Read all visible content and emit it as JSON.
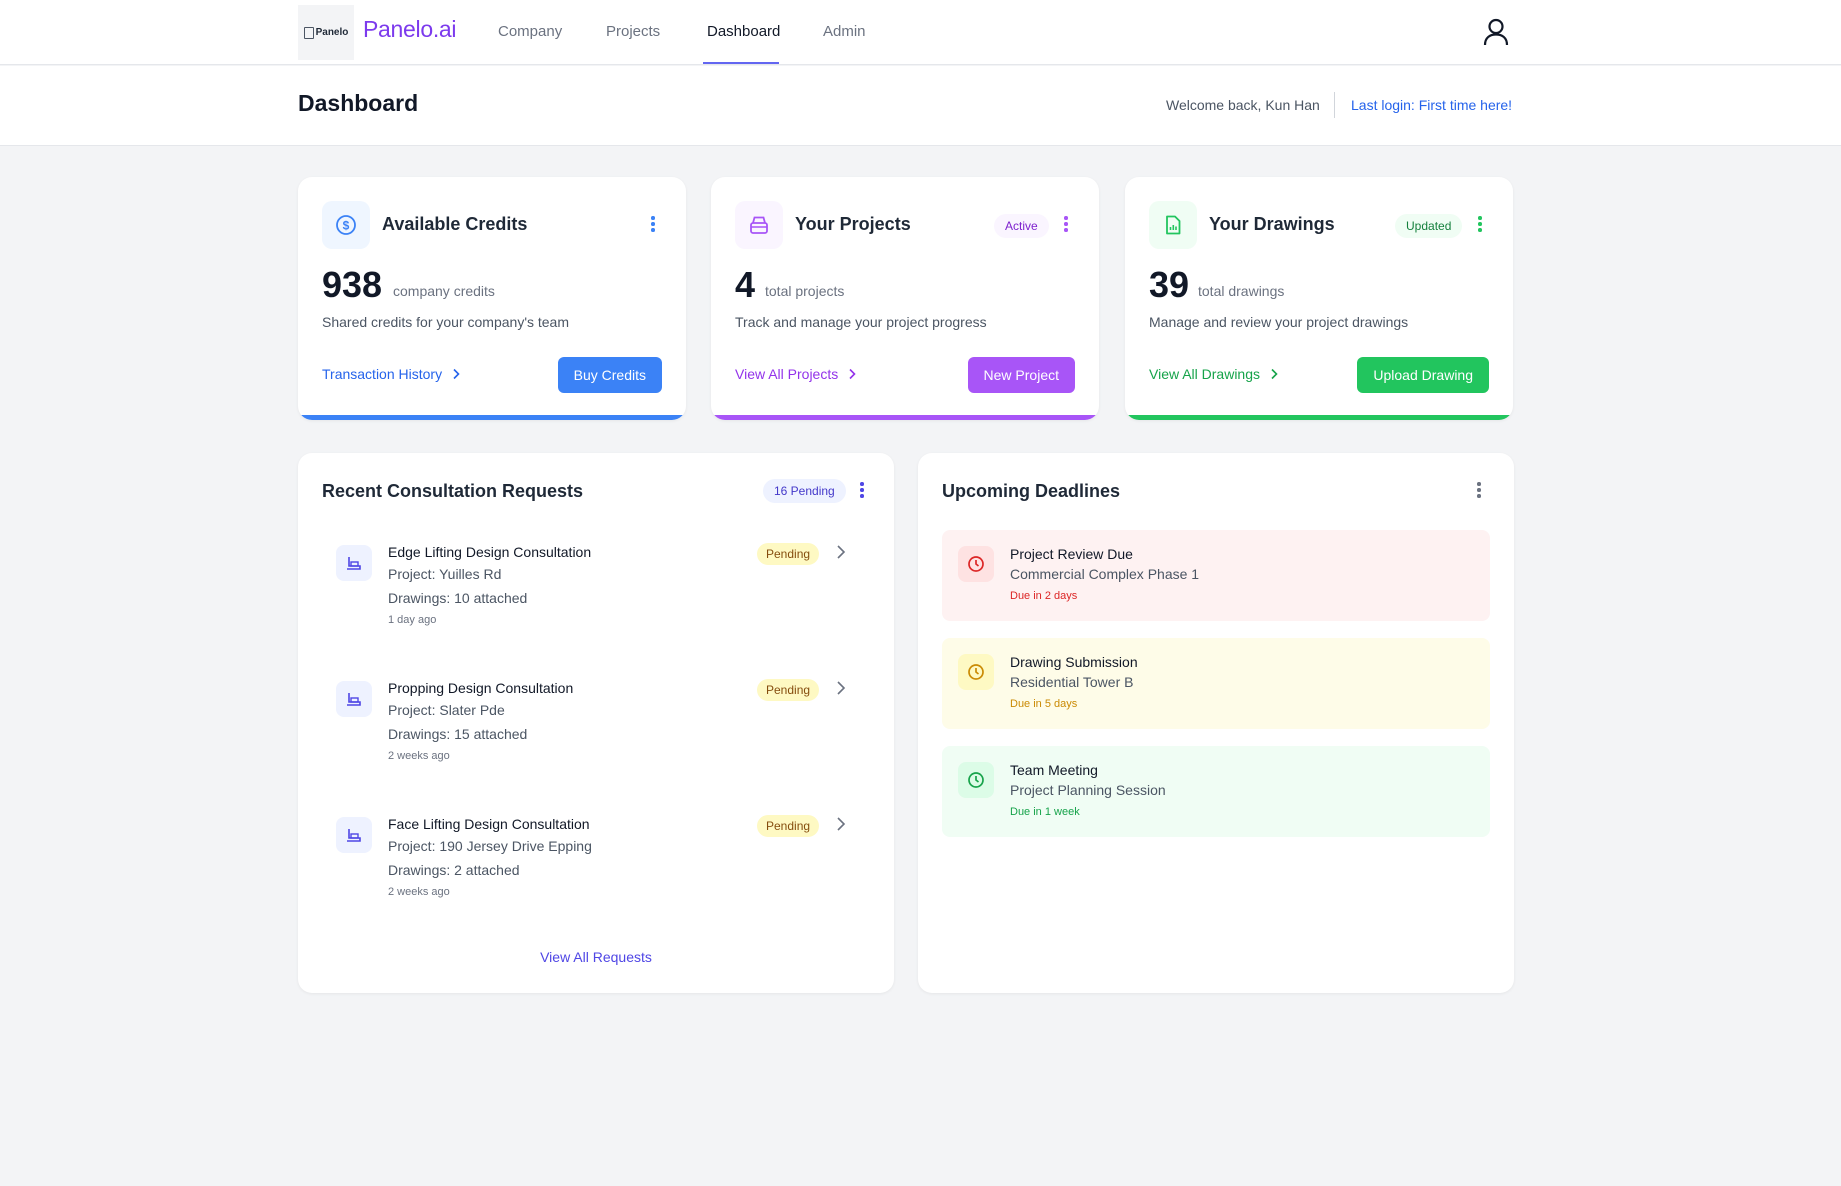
{
  "nav": {
    "logo_text": "Panelo",
    "brand": "Panelo.ai",
    "links": [
      "Company",
      "Projects",
      "Dashboard",
      "Admin"
    ],
    "active": "Dashboard",
    "user_icon": "user-icon"
  },
  "header": {
    "title": "Dashboard",
    "welcome": "Welcome back, Kun Han",
    "last_login": "Last login: First time here!"
  },
  "stats": {
    "credits": {
      "title": "Available Credits",
      "icon": "dollar-circle-icon",
      "value": "938",
      "unit": "company credits",
      "desc": "Shared credits for your company's team",
      "link": "Transaction History",
      "button": "Buy Credits",
      "accent": "#3b82f6"
    },
    "projects": {
      "title": "Your Projects",
      "icon": "archive-box-icon",
      "badge": "Active",
      "value": "4",
      "unit": "total projects",
      "desc": "Track and manage your project progress",
      "link": "View All Projects",
      "button": "New Project",
      "accent": "#a855f7"
    },
    "drawings": {
      "title": "Your Drawings",
      "icon": "document-chart-icon",
      "badge": "Updated",
      "value": "39",
      "unit": "total drawings",
      "desc": "Manage and review your project drawings",
      "link": "View All Drawings",
      "button": "Upload Drawing",
      "accent": "#22c55e"
    }
  },
  "requests": {
    "title": "Recent Consultation Requests",
    "badge": "16 Pending",
    "items": [
      {
        "title": "Edge Lifting Design Consultation",
        "project": "Project: Yuilles Rd",
        "drawings": "Drawings: 10 attached",
        "time": "1 day ago",
        "status": "Pending"
      },
      {
        "title": "Propping Design Consultation",
        "project": "Project: Slater Pde",
        "drawings": "Drawings: 15 attached",
        "time": "2 weeks ago",
        "status": "Pending"
      },
      {
        "title": "Face Lifting Design Consultation",
        "project": "Project: 190 Jersey Drive Epping",
        "drawings": "Drawings: 2 attached",
        "time": "2 weeks ago",
        "status": "Pending"
      }
    ],
    "view_all": "View All Requests"
  },
  "deadlines": {
    "title": "Upcoming Deadlines",
    "items": [
      {
        "title": "Project Review Due",
        "sub": "Commercial Complex Phase 1",
        "due": "Due in 2 days",
        "color": "#dc2626",
        "bg": "#fef2f2"
      },
      {
        "title": "Drawing Submission",
        "sub": "Residential Tower B",
        "due": "Due in 5 days",
        "color": "#ca8a04",
        "bg": "#fefce8"
      },
      {
        "title": "Team Meeting",
        "sub": "Project Planning Session",
        "due": "Due in 1 week",
        "color": "#16a34a",
        "bg": "#f0fdf4"
      }
    ]
  }
}
